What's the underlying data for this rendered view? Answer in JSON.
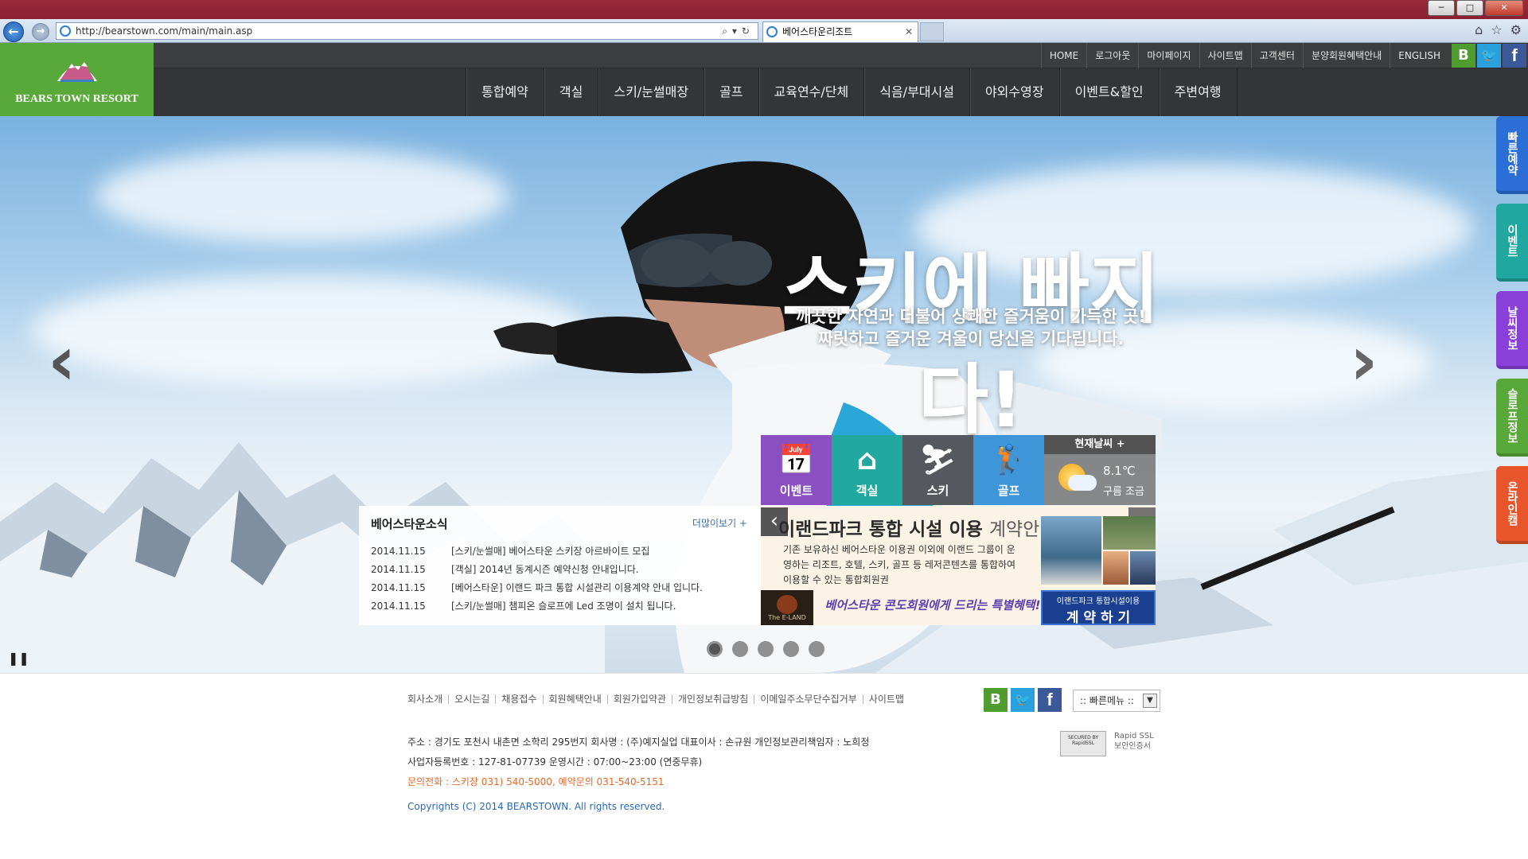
{
  "browser": {
    "window_title": "",
    "url": "http://bearstown.com/main/main.asp",
    "tab_title": "베어스타운리조트",
    "window_buttons": [
      "─",
      "□",
      "✕"
    ]
  },
  "site": {
    "logo_text": "BEARS TOWN RESORT",
    "utility_nav": [
      "HOME",
      "로그아웃",
      "마이페이지",
      "사이트맵",
      "고객센터",
      "분양회원혜택안내",
      "ENGLISH"
    ],
    "social": [
      {
        "name": "b-social-icon",
        "glyph": "B"
      },
      {
        "name": "twitter-icon",
        "glyph": "🐦"
      },
      {
        "name": "facebook-icon",
        "glyph": "f"
      }
    ],
    "main_nav": [
      "통합예약",
      "객실",
      "스키/눈썰매장",
      "골프",
      "교육연수/단체",
      "식음/부대시설",
      "야외수영장",
      "이벤트&할인",
      "주변여행"
    ]
  },
  "hero": {
    "title": "스키에 빠지다!",
    "subtitle_line1": "깨끗한 자연과 더불어 상쾌한 즐거움이 가득한 곳!",
    "subtitle_line2": "짜릿하고 즐거운 겨울이 당신을 기다립니다.",
    "prev_arrow": "‹",
    "next_arrow": "›",
    "pause": "❚❚",
    "slide_count": 5,
    "active_slide": 1
  },
  "side_tabs": [
    {
      "label": "빠른예약",
      "color": "#2b6fd6"
    },
    {
      "label": "이벤트",
      "color": "#1fa7a0"
    },
    {
      "label": "날씨정보",
      "color": "#8a3fd9"
    },
    {
      "label": "슬로프정보",
      "color": "#58a83a"
    },
    {
      "label": "온라인캠",
      "color": "#e8552a"
    }
  ],
  "news": {
    "title": "베어스타운소식",
    "more": "더많이보기 +",
    "items": [
      {
        "date": "2014.11.15",
        "text": "[스키/눈썰매] 베어스타운 스키장 아르바이트 모집"
      },
      {
        "date": "2014.11.15",
        "text": "[객실] 2014년 동계시즌 예약신청 안내입니다."
      },
      {
        "date": "2014.11.15",
        "text": "[베어스타운] 이랜드 파크 통합 시설관리 이용계약 안내 입니다."
      },
      {
        "date": "2014.11.15",
        "text": "[스키/눈썰매] 챔피온 슬로프에 Led 조명이 설치 됩니다."
      }
    ]
  },
  "quick_icons": [
    {
      "name": "calendar-icon",
      "label": "이벤트",
      "glyph": "📅",
      "color": "#8a4fc0"
    },
    {
      "name": "house-icon",
      "label": "객실",
      "glyph": "⌂",
      "color": "#22a99f"
    },
    {
      "name": "skier-icon",
      "label": "스키",
      "glyph": "⛷",
      "color": "#55585c"
    },
    {
      "name": "golfer-icon",
      "label": "골프",
      "glyph": "🏌",
      "color": "#3e95d8"
    }
  ],
  "weather": {
    "header": "현재날씨 +",
    "temperature": "8.1℃",
    "condition": "구름 조금"
  },
  "promo": {
    "title_main": "이랜드파크 통합 시설 이용",
    "title_tail": "계약안내",
    "body": "기존 보유하신 베어스타운 이용권 이외에 이랜드 그룹이 운영하는 리조트, 호텔, 스키, 골프 등 레저콘텐츠를 통합하여 이용할 수 있는 통합회원권",
    "script_text": "베어스타운 콘도회원에게 드리는 특별혜택!",
    "eland_label": "The E-LAND",
    "button_small": "이랜드파크 통합시설이용",
    "button_big": "계 약 하 기"
  },
  "footer": {
    "links": [
      "회사소개",
      "오시는길",
      "채용접수",
      "회원혜택안내",
      "회원가입약관",
      "개인정보취급방침",
      "이메일주소무단수집거부",
      "사이트맵"
    ],
    "quick_menu": ":: 빠른메뉴 ::",
    "info_line1": "주소 : 경기도 포천시 내촌면 소학리 295번지    회사명 : (주)예지실업    대표이사 : 손규원    개인정보관리책임자 : 노희정",
    "info_line2": "사업자등록번호 : 127-81-07739    운영시간 : 07:00~23:00 (연중무휴)",
    "info_line3": "문의전화 : 스키장 031) 540-5000, 예약문의 031-540-5151",
    "copyright": "Copyrights (C) 2014 BEARSTOWN. All rights reserved.",
    "ssl_badge": "SECURED BY RapidSSL",
    "ssl_text1": "Rapid SSL",
    "ssl_text2": "보안인증서"
  }
}
